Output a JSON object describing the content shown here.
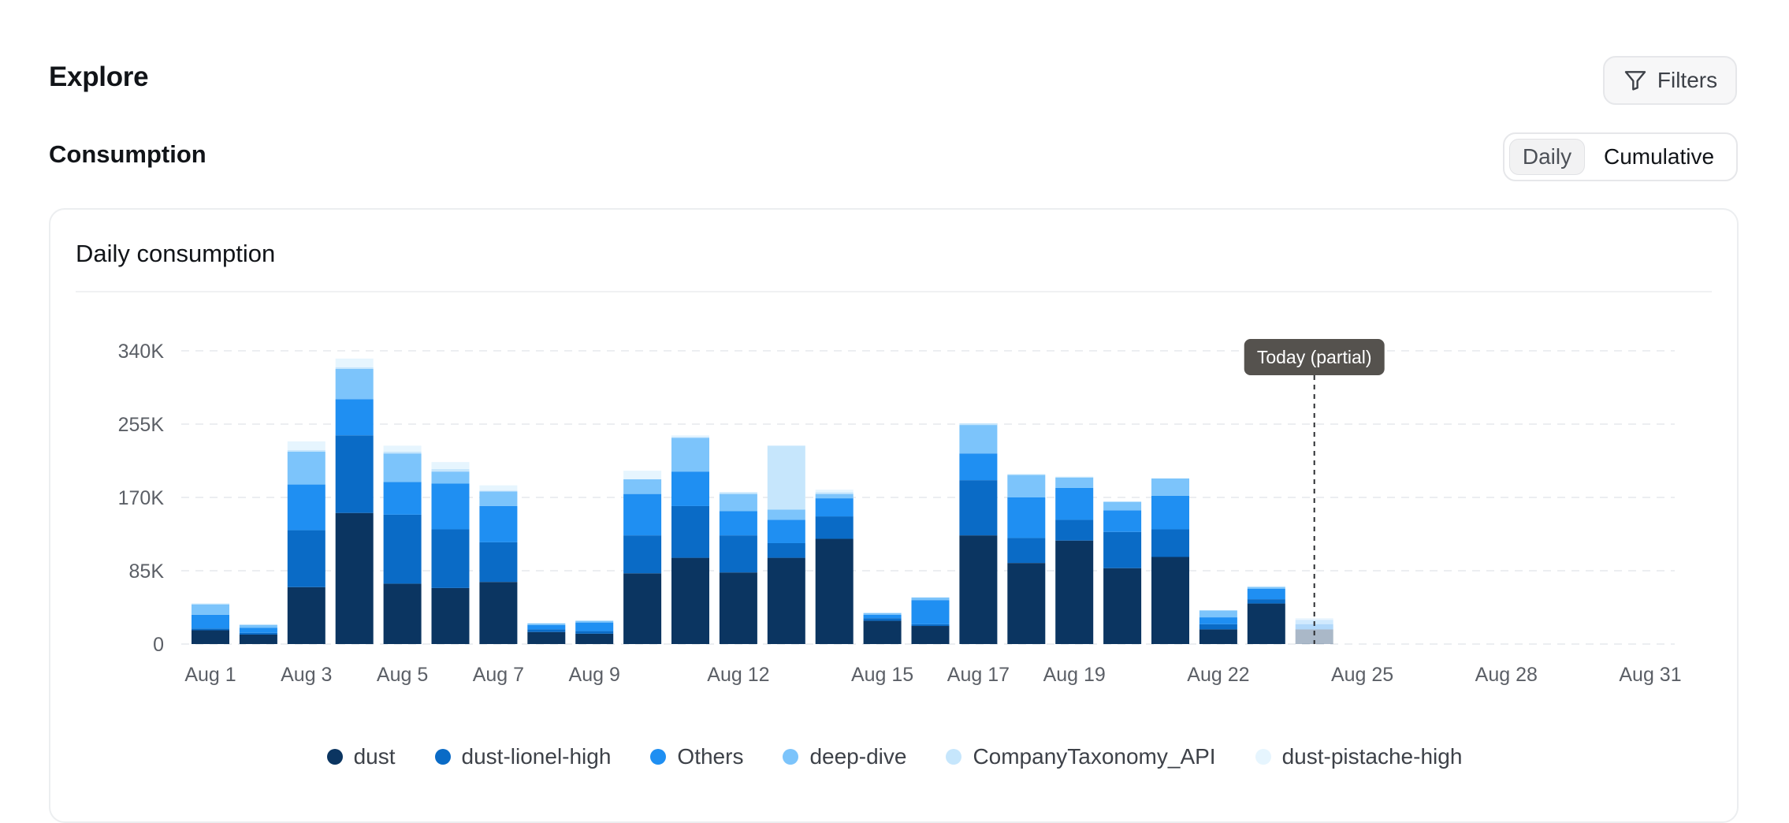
{
  "header": {
    "title": "Explore",
    "filters_label": "Filters"
  },
  "section": {
    "title": "Consumption",
    "toggle": {
      "daily": "Daily",
      "cumulative": "Cumulative",
      "selected": "Daily"
    }
  },
  "card": {
    "title": "Daily consumption"
  },
  "chart_data": {
    "type": "bar",
    "stacked": true,
    "title": "Daily consumption",
    "xlabel": "",
    "ylabel": "",
    "ylim": [
      0,
      340000
    ],
    "yticks": [
      0,
      85000,
      170000,
      255000,
      340000
    ],
    "ytick_labels": [
      "0",
      "85K",
      "170K",
      "255K",
      "340K"
    ],
    "grid": true,
    "legend_position": "bottom",
    "categories": [
      "Aug 1",
      "Aug 2",
      "Aug 3",
      "Aug 4",
      "Aug 5",
      "Aug 6",
      "Aug 7",
      "Aug 8",
      "Aug 9",
      "Aug 10",
      "Aug 11",
      "Aug 12",
      "Aug 13",
      "Aug 14",
      "Aug 15",
      "Aug 16",
      "Aug 17",
      "Aug 18",
      "Aug 19",
      "Aug 20",
      "Aug 21",
      "Aug 22",
      "Aug 23",
      "Aug 24",
      "Aug 25",
      "Aug 26",
      "Aug 27",
      "Aug 28",
      "Aug 29",
      "Aug 30",
      "Aug 31"
    ],
    "xtick_labels": [
      {
        "index": 0,
        "label": "Aug 1"
      },
      {
        "index": 2,
        "label": "Aug 3"
      },
      {
        "index": 4,
        "label": "Aug 5"
      },
      {
        "index": 6,
        "label": "Aug 7"
      },
      {
        "index": 8,
        "label": "Aug 9"
      },
      {
        "index": 11,
        "label": "Aug 12"
      },
      {
        "index": 14,
        "label": "Aug 15"
      },
      {
        "index": 16,
        "label": "Aug 17"
      },
      {
        "index": 18,
        "label": "Aug 19"
      },
      {
        "index": 21,
        "label": "Aug 22"
      },
      {
        "index": 24,
        "label": "Aug 25"
      },
      {
        "index": 27,
        "label": "Aug 28"
      },
      {
        "index": 30,
        "label": "Aug 31"
      }
    ],
    "series": [
      {
        "name": "dust",
        "color": "#0b3561",
        "values": [
          16000,
          11000,
          66000,
          152000,
          70000,
          65000,
          72000,
          14000,
          12000,
          82000,
          100000,
          83000,
          100000,
          122000,
          27000,
          21000,
          126000,
          94000,
          120000,
          88000,
          101000,
          17000,
          47000,
          17000,
          0,
          0,
          0,
          0,
          0,
          0,
          0
        ]
      },
      {
        "name": "dust-lionel-high",
        "color": "#0a6bc6",
        "values": [
          2000,
          2000,
          66000,
          90000,
          80000,
          68000,
          46000,
          3000,
          3000,
          44000,
          60000,
          43000,
          17000,
          26000,
          3000,
          2000,
          64000,
          29000,
          24000,
          42000,
          32000,
          6000,
          5000,
          0,
          0,
          0,
          0,
          0,
          0,
          0,
          0
        ]
      },
      {
        "name": "Others",
        "color": "#1f8ff2",
        "values": [
          16000,
          6000,
          53000,
          42000,
          38000,
          53000,
          42000,
          5000,
          10000,
          48000,
          40000,
          28000,
          27000,
          21000,
          4000,
          28000,
          31000,
          47000,
          37000,
          25000,
          39000,
          8000,
          12000,
          6000,
          0,
          0,
          0,
          0,
          0,
          0,
          0
        ]
      },
      {
        "name": "deep-dive",
        "color": "#7cc4fb",
        "values": [
          12000,
          3000,
          38000,
          35000,
          33000,
          14000,
          17000,
          2000,
          2000,
          17000,
          39000,
          20000,
          12000,
          5000,
          2000,
          3000,
          33000,
          26000,
          12000,
          10000,
          20000,
          8000,
          2000,
          5000,
          0,
          0,
          0,
          0,
          0,
          0,
          0
        ]
      },
      {
        "name": "CompanyTaxonomy_API",
        "color": "#c6e6fc",
        "values": [
          1000,
          1000,
          2000,
          2000,
          2000,
          3000,
          1000,
          0,
          0,
          0,
          1000,
          2000,
          74000,
          2000,
          0,
          0,
          2000,
          1000,
          1000,
          0,
          0,
          0,
          1000,
          2000,
          0,
          0,
          0,
          0,
          0,
          0,
          0
        ]
      },
      {
        "name": "dust-pistache-high",
        "color": "#e6f5fe",
        "values": [
          0,
          0,
          10000,
          10000,
          7000,
          8000,
          6000,
          0,
          0,
          10000,
          2000,
          0,
          0,
          3000,
          0,
          0,
          0,
          0,
          0,
          0,
          0,
          0,
          0,
          0,
          0,
          0,
          0,
          0,
          0,
          0,
          0
        ]
      }
    ],
    "partial_index": 23,
    "annotation": {
      "label": "Today (partial)",
      "index": 23
    }
  }
}
